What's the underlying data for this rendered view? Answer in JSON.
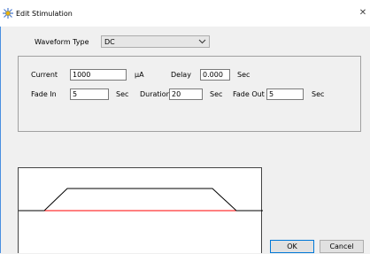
{
  "window": {
    "title": "Edit Stimulation",
    "close_glyph": "✕",
    "icon": "stimulation-app-icon"
  },
  "waveform": {
    "label": "Waveform Type",
    "selected": "DC"
  },
  "current": {
    "label": "Current",
    "value": "1000",
    "unit": "μA"
  },
  "delay": {
    "label": "Delay",
    "value": "0.000",
    "unit": "Sec"
  },
  "fade_in": {
    "label": "Fade In",
    "value": "5",
    "unit": "Sec"
  },
  "duration": {
    "label": "Duration",
    "value": "20",
    "unit": "Sec"
  },
  "fade_out": {
    "label": "Fade Out",
    "value": "5",
    "unit": "Sec"
  },
  "buttons": {
    "ok": "OK",
    "cancel": "Cancel"
  },
  "colors": {
    "baseline": "#ff0000",
    "waveform": "#000000",
    "accent": "#0078d7"
  }
}
